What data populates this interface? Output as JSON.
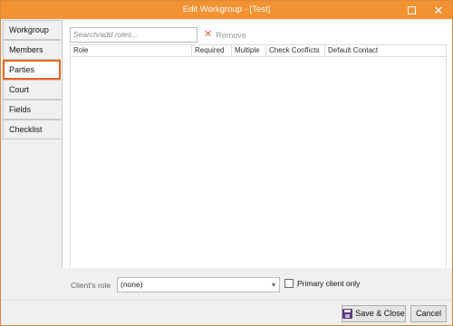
{
  "window": {
    "title": "Edit Workgroup - [Test]",
    "accent_color": "#f39232"
  },
  "tabs": [
    {
      "label": "Workgroup",
      "active": false
    },
    {
      "label": "Members",
      "active": false
    },
    {
      "label": "Parties",
      "active": true
    },
    {
      "label": "Court",
      "active": false
    },
    {
      "label": "Fields",
      "active": false
    },
    {
      "label": "Checklist",
      "active": false
    }
  ],
  "toolbar": {
    "search_placeholder": "Search/add roles...",
    "remove_label": "Remove"
  },
  "grid": {
    "columns": [
      "Role",
      "Required",
      "Multiple",
      "Check Conflicts",
      "Default Contact"
    ],
    "rows": []
  },
  "client_role": {
    "label": "Client's role",
    "value": "(none)",
    "primary_only_label": "Primary client only",
    "primary_only_checked": false
  },
  "footer": {
    "save_label": "Save & Close",
    "cancel_label": "Cancel"
  },
  "icons": {
    "maximize": "maximize-icon",
    "close": "close-icon",
    "remove": "remove-x-icon",
    "save": "floppy-disk-icon",
    "dropdown": "chevron-down-icon"
  }
}
